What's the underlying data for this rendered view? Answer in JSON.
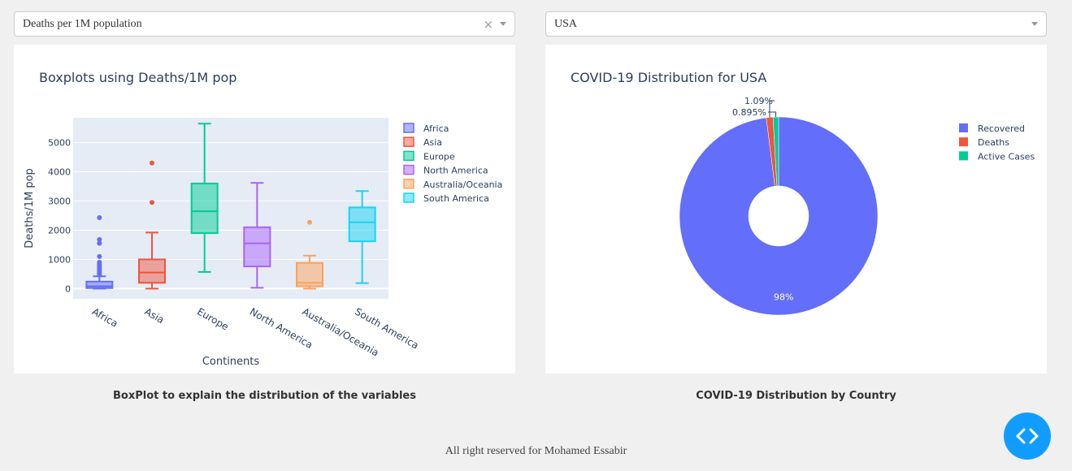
{
  "left_dropdown": {
    "value": "Deaths per 1M population",
    "clear_symbol": "×"
  },
  "right_dropdown": {
    "value": "USA"
  },
  "captions": {
    "left": "BoxPlot to explain the distribution of the variables",
    "right": "COVID-19 Distribution by Country"
  },
  "footer": "All right reserved for Mohamed Essabir",
  "chart_data": [
    {
      "type": "box",
      "title": "Boxplots using Deaths/1M pop",
      "xlabel": "Continents",
      "ylabel": "Deaths/1M pop",
      "ylim": [
        -350,
        5850
      ],
      "yticks": [
        0,
        1000,
        2000,
        3000,
        4000,
        5000
      ],
      "legend_position": "right",
      "grid": true,
      "series": [
        {
          "name": "Africa",
          "color": "#636efa",
          "min": 0,
          "q1": 20,
          "median": 80,
          "q3": 240,
          "max": 420,
          "outliers": [
            480,
            520,
            560,
            600,
            650,
            700,
            760,
            820,
            900,
            1100,
            1550,
            1680,
            2430
          ]
        },
        {
          "name": "Asia",
          "color": "#ef553b",
          "min": 0,
          "q1": 200,
          "median": 550,
          "q3": 1000,
          "max": 1920,
          "outliers": [
            2950,
            4300
          ]
        },
        {
          "name": "Europe",
          "color": "#00cc96",
          "min": 570,
          "q1": 1900,
          "median": 2650,
          "q3": 3600,
          "max": 5650,
          "outliers": []
        },
        {
          "name": "North America",
          "color": "#ab63fa",
          "min": 30,
          "q1": 760,
          "median": 1550,
          "q3": 2100,
          "max": 3620,
          "outliers": []
        },
        {
          "name": "Australia/Oceania",
          "color": "#ffa15a",
          "min": 0,
          "q1": 80,
          "median": 200,
          "q3": 880,
          "max": 1130,
          "outliers": [
            2270
          ]
        },
        {
          "name": "South America",
          "color": "#19d3f3",
          "min": 190,
          "q1": 1620,
          "median": 2270,
          "q3": 2780,
          "max": 3340,
          "outliers": []
        }
      ]
    },
    {
      "type": "pie",
      "title": "COVID-19 Distribution for USA",
      "hole": true,
      "legend_position": "top-right",
      "slices": [
        {
          "label": "Recovered",
          "value": 98.015,
          "text": "98%",
          "color": "#636efa"
        },
        {
          "label": "Deaths",
          "value": 1.09,
          "text": "1.09%",
          "color": "#ef553b"
        },
        {
          "label": "Active Cases",
          "value": 0.895,
          "text": "0.895%",
          "color": "#00cc96"
        }
      ]
    }
  ]
}
